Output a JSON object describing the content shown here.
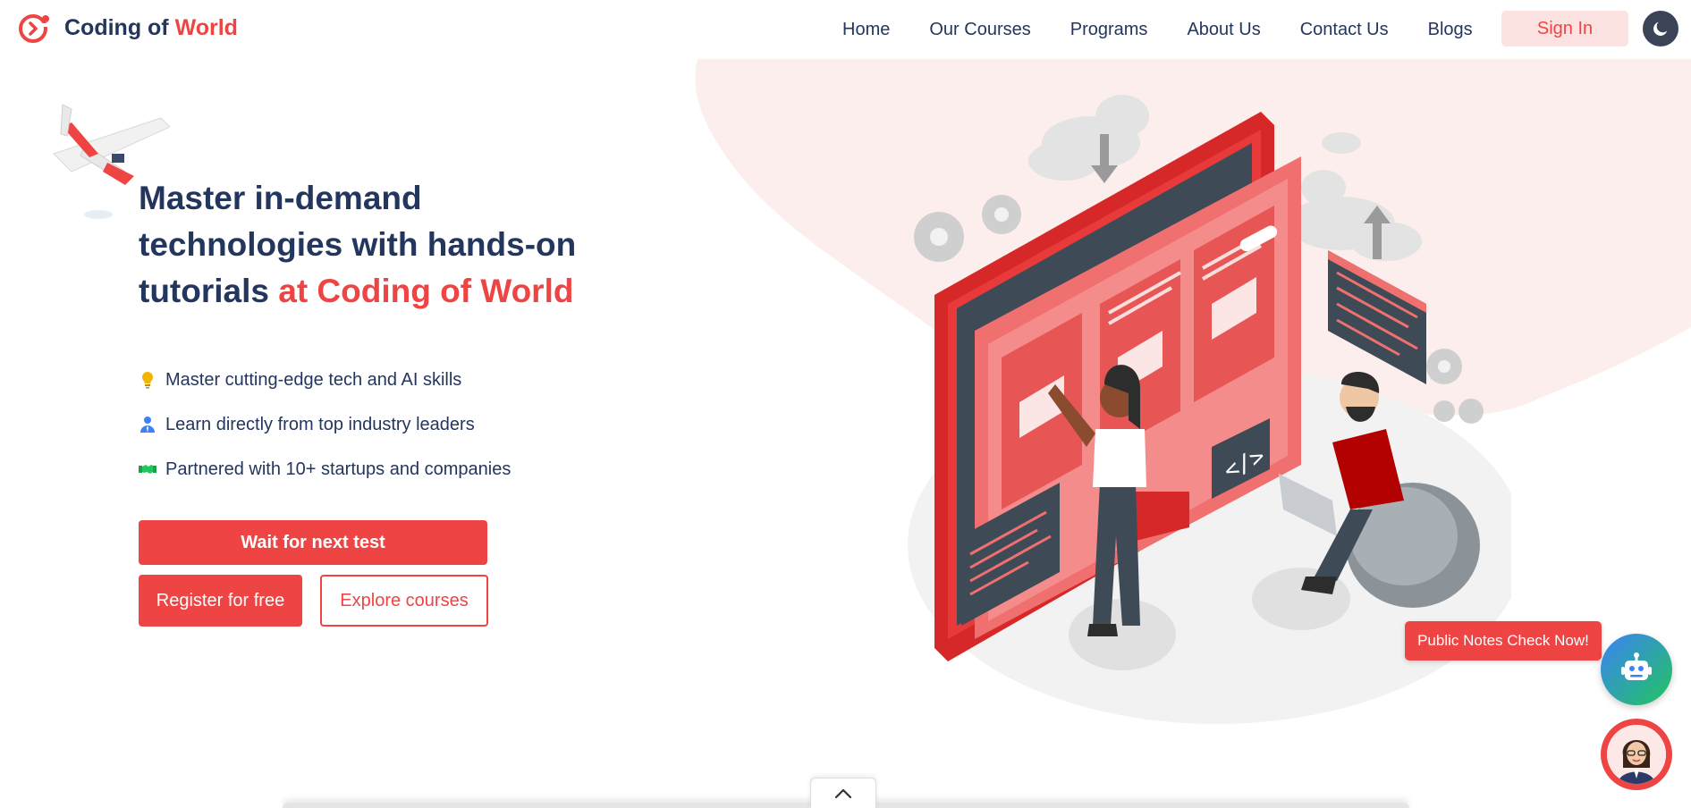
{
  "brand": {
    "name_part1": "Coding of ",
    "name_part2": "World",
    "logo_icon": "coding-of-world-logo"
  },
  "nav": {
    "links": [
      "Home",
      "Our Courses",
      "Programs",
      "About Us",
      "Contact Us",
      "Blogs"
    ],
    "signin_label": "Sign In",
    "theme_icon": "moon-icon"
  },
  "hero": {
    "headline_line1": "Master in-demand",
    "headline_line2": "technologies with hands-on",
    "headline_line3_plain": "tutorials ",
    "headline_line3_accent": "at Coding of World",
    "features": [
      {
        "icon": "lightbulb-icon",
        "text": "Master cutting-edge tech and AI skills"
      },
      {
        "icon": "user-icon",
        "text": "Learn directly from top industry leaders"
      },
      {
        "icon": "handshake-icon",
        "text": "Partnered with 10+ startups and companies"
      }
    ],
    "wait_button": "Wait for next test",
    "register_button": "Register for free",
    "explore_button": "Explore courses"
  },
  "floating": {
    "notes_label": "Public Notes Check Now!",
    "bot_icon": "robot-icon",
    "avatar_icon": "assistant-avatar"
  },
  "scroll": {
    "icon": "chevron-up-icon"
  },
  "colors": {
    "accent": "#ef4444",
    "navy": "#23365e",
    "blob": "#fdeeee"
  }
}
